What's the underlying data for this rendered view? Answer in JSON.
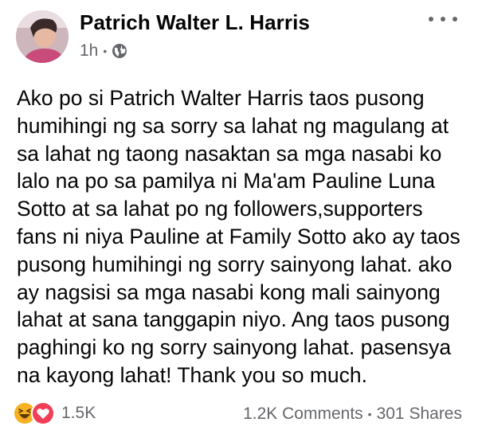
{
  "post": {
    "author": "Patrich Walter L. Harris",
    "time": "1h",
    "separator": "•",
    "audience_icon": "globe-icon",
    "more_icon": "more-options-icon",
    "text": "Ako po si Patrich Walter Harris taos pusong\nhumihingi ng sa sorry sa lahat ng magulang at\nsa lahat ng taong nasaktan sa mga nasabi ko\nlalo na po sa pamilya ni Ma'am Pauline Luna\nSotto at sa lahat po ng followers,supporters\nfans ni niya Pauline at Family Sotto ako ay taos\npusong humihingi ng sorry sainyong lahat. ako\nay nagsisi sa mga nasabi kong mali sainyong\nlahat at sana tanggapin niyo. Ang taos pusong\npaghingi ko ng sorry sainyong lahat. pasensya\nna kayong lahat! Thank you so much."
  },
  "footer": {
    "reaction_icons": [
      "haha-reaction-icon",
      "love-reaction-icon"
    ],
    "reaction_count": "1.5K",
    "comments": "1.2K Comments",
    "separator": "•",
    "shares": "301 Shares"
  },
  "colors": {
    "text_primary": "#050505",
    "text_secondary": "#65676b",
    "haha_yellow": "#f7b125",
    "love_red": "#f33e58"
  }
}
